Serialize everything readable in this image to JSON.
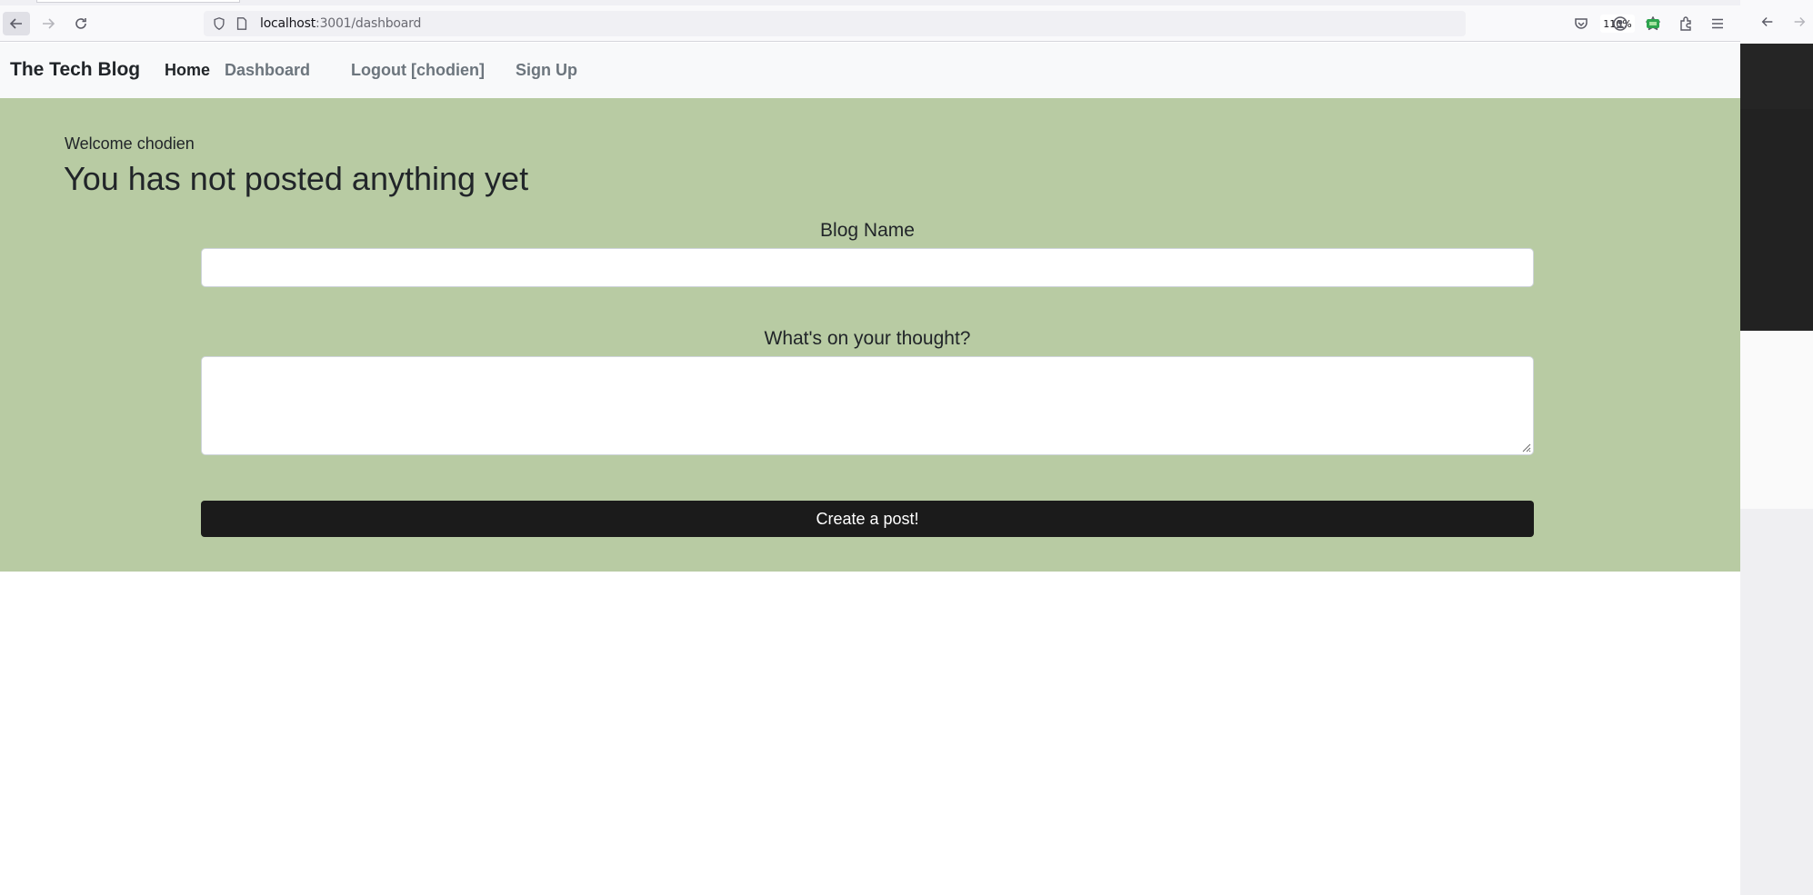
{
  "browser": {
    "url_host": "localhost",
    "url_path": ":3001/dashboard",
    "zoom": "110%"
  },
  "navbar": {
    "brand": "The Tech Blog",
    "links": [
      {
        "label": "Home"
      },
      {
        "label": "Dashboard"
      },
      {
        "label": "Logout [chodien]"
      },
      {
        "label": "Sign Up"
      }
    ]
  },
  "main": {
    "welcome": "Welcome chodien",
    "headline": "You has not posted anything yet",
    "form": {
      "title_label": "Blog Name",
      "title_value": "",
      "body_label": "What's on your thought?",
      "body_value": "",
      "submit_label": "Create a post!"
    }
  },
  "colors": {
    "content_bg": "#b8cba3",
    "navbar_bg": "#f8f9fa",
    "button_bg": "#1b1b1b"
  }
}
